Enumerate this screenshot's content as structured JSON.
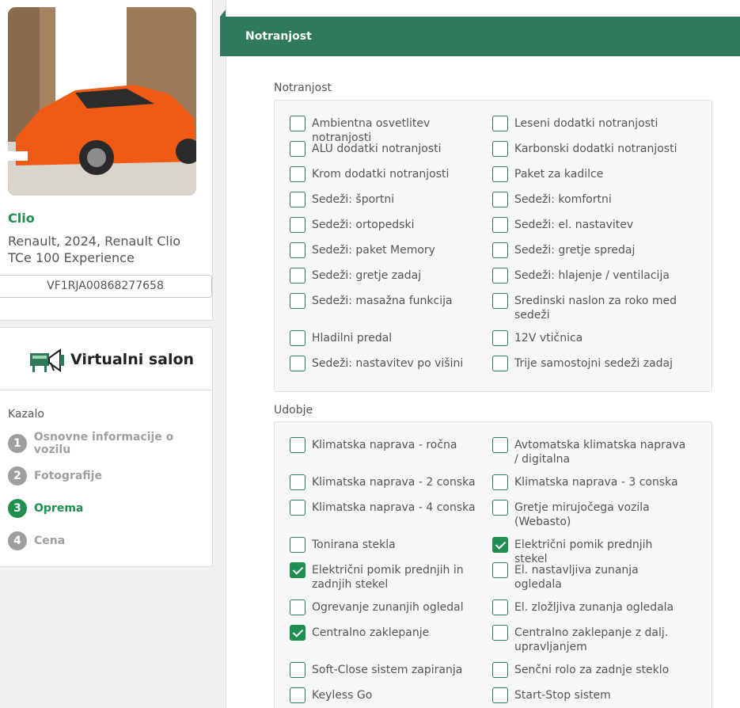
{
  "vehicle": {
    "title": "Clio",
    "description": "Renault, 2024, Renault Clio TCe 100 Experience",
    "vin": "VF1RJA00868277658"
  },
  "salon": {
    "title": "Virtualni salon",
    "toc_label": "Kazalo",
    "toc": [
      {
        "num": "1",
        "label": "Osnovne informacije o vozilu",
        "active": false
      },
      {
        "num": "2",
        "label": "Fotografije",
        "active": false
      },
      {
        "num": "3",
        "label": "Oprema",
        "active": true
      },
      {
        "num": "4",
        "label": "Cena",
        "active": false
      }
    ]
  },
  "section": {
    "title": "Notranjost"
  },
  "groups": [
    {
      "label": "Notranjost",
      "options": [
        {
          "label": "Ambientna osvetlitev notranjosti",
          "checked": false
        },
        {
          "label": "Leseni dodatki notranjosti",
          "checked": false
        },
        {
          "label": "ALU dodatki notranjosti",
          "checked": false
        },
        {
          "label": "Karbonski dodatki notranjosti",
          "checked": false
        },
        {
          "label": "Krom dodatki notranjosti",
          "checked": false
        },
        {
          "label": "Paket za kadilce",
          "checked": false
        },
        {
          "label": "Sedeži: športni",
          "checked": false
        },
        {
          "label": "Sedeži: komfortni",
          "checked": false
        },
        {
          "label": "Sedeži: ortopedski",
          "checked": false
        },
        {
          "label": "Sedeži: el. nastavitev",
          "checked": false
        },
        {
          "label": "Sedeži: paket Memory",
          "checked": false
        },
        {
          "label": "Sedeži: gretje spredaj",
          "checked": false
        },
        {
          "label": "Sedeži: gretje zadaj",
          "checked": false
        },
        {
          "label": "Sedeži: hlajenje / ventilacija",
          "checked": false
        },
        {
          "label": "Sedeži: masažna funkcija",
          "checked": false
        },
        {
          "label": "Sredinski naslon za roko med sedeži",
          "checked": false
        },
        {
          "label": "Hladilni predal",
          "checked": false
        },
        {
          "label": "12V vtičnica",
          "checked": false
        },
        {
          "label": "Sedeži: nastavitev po višini",
          "checked": false
        },
        {
          "label": "Trije samostojni sedeži zadaj",
          "checked": false
        }
      ]
    },
    {
      "label": "Udobje",
      "options": [
        {
          "label": "Klimatska naprava - ročna",
          "checked": false
        },
        {
          "label": "Avtomatska klimatska naprava / digitalna",
          "checked": false
        },
        {
          "label": "Klimatska naprava - 2 conska",
          "checked": false
        },
        {
          "label": "Klimatska naprava - 3 conska",
          "checked": false
        },
        {
          "label": "Klimatska naprava - 4 conska",
          "checked": false
        },
        {
          "label": "Gretje mirujočega vozila (Webasto)",
          "checked": false
        },
        {
          "label": "Tonirana stekla",
          "checked": false
        },
        {
          "label": "Električni pomik prednjih stekel",
          "checked": true
        },
        {
          "label": "Električni pomik prednjih in zadnjih stekel",
          "checked": true
        },
        {
          "label": "El. nastavljiva zunanja ogledala",
          "checked": false
        },
        {
          "label": "Ogrevanje zunanjih ogledal",
          "checked": false
        },
        {
          "label": "El. zložljiva zunanja ogledala",
          "checked": false
        },
        {
          "label": "Centralno zaklepanje",
          "checked": true
        },
        {
          "label": "Centralno zaklepanje z dalj. upravljanjem",
          "checked": false
        },
        {
          "label": "Soft-Close sistem zapiranja",
          "checked": false
        },
        {
          "label": "Senčni rolo za zadnje steklo",
          "checked": false
        },
        {
          "label": "Keyless Go",
          "checked": false
        },
        {
          "label": "Start-Stop sistem",
          "checked": false
        }
      ]
    }
  ]
}
